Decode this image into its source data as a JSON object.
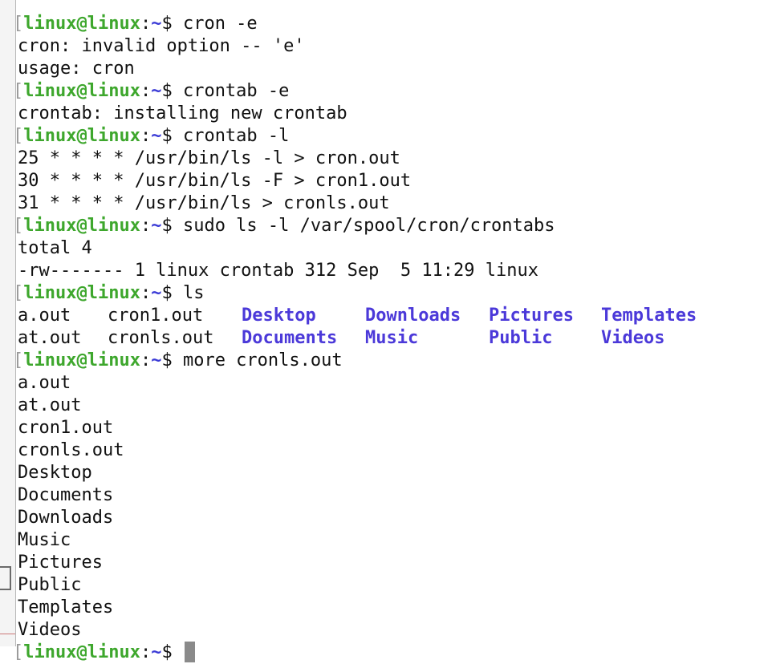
{
  "prompt": {
    "user_host": "linux@linux",
    "sep": ":",
    "path": "~",
    "symbol": "$ "
  },
  "lines": [
    {
      "type": "cmd",
      "cmd": "cron -e"
    },
    {
      "type": "out",
      "text": "cron: invalid option -- 'e'"
    },
    {
      "type": "out",
      "text": "usage: cron"
    },
    {
      "type": "cmd",
      "cmd": "crontab -e"
    },
    {
      "type": "out",
      "text": "crontab: installing new crontab"
    },
    {
      "type": "cmd",
      "cmd": "crontab -l"
    },
    {
      "type": "out",
      "text": "25 * * * * /usr/bin/ls -l > cron.out"
    },
    {
      "type": "out",
      "text": "30 * * * * /usr/bin/ls -F > cron1.out"
    },
    {
      "type": "out",
      "text": "31 * * * * /usr/bin/ls > cronls.out"
    },
    {
      "type": "cmd",
      "cmd": "sudo ls -l /var/spool/cron/crontabs"
    },
    {
      "type": "out",
      "text": "total 4"
    },
    {
      "type": "out",
      "text": "-rw------- 1 linux crontab 312 Sep  5 11:29 linux"
    },
    {
      "type": "cmd",
      "cmd": "ls"
    },
    {
      "type": "lsrow",
      "cells": [
        {
          "text": "a.out",
          "dir": false
        },
        {
          "text": "cron1.out",
          "dir": false
        },
        {
          "text": "Desktop",
          "dir": true
        },
        {
          "text": "Downloads",
          "dir": true
        },
        {
          "text": "Pictures",
          "dir": true
        },
        {
          "text": "Templates",
          "dir": true
        }
      ]
    },
    {
      "type": "lsrow",
      "cells": [
        {
          "text": "at.out",
          "dir": false
        },
        {
          "text": "cronls.out",
          "dir": false
        },
        {
          "text": "Documents",
          "dir": true
        },
        {
          "text": "Music",
          "dir": true
        },
        {
          "text": "Public",
          "dir": true
        },
        {
          "text": "Videos",
          "dir": true
        }
      ]
    },
    {
      "type": "cmd",
      "cmd": "more cronls.out"
    },
    {
      "type": "out",
      "text": "a.out"
    },
    {
      "type": "out",
      "text": "at.out"
    },
    {
      "type": "out",
      "text": "cron1.out"
    },
    {
      "type": "out",
      "text": "cronls.out"
    },
    {
      "type": "out",
      "text": "Desktop"
    },
    {
      "type": "out",
      "text": "Documents"
    },
    {
      "type": "out",
      "text": "Downloads"
    },
    {
      "type": "out",
      "text": "Music"
    },
    {
      "type": "out",
      "text": "Pictures"
    },
    {
      "type": "out",
      "text": "Public"
    },
    {
      "type": "out",
      "text": "Templates"
    },
    {
      "type": "out",
      "text": "Videos"
    },
    {
      "type": "cmd",
      "cmd": "",
      "cursor": true
    }
  ],
  "colors": {
    "user": "#3ea72d",
    "path": "#3a3ad6",
    "dir": "#4b39d9"
  }
}
